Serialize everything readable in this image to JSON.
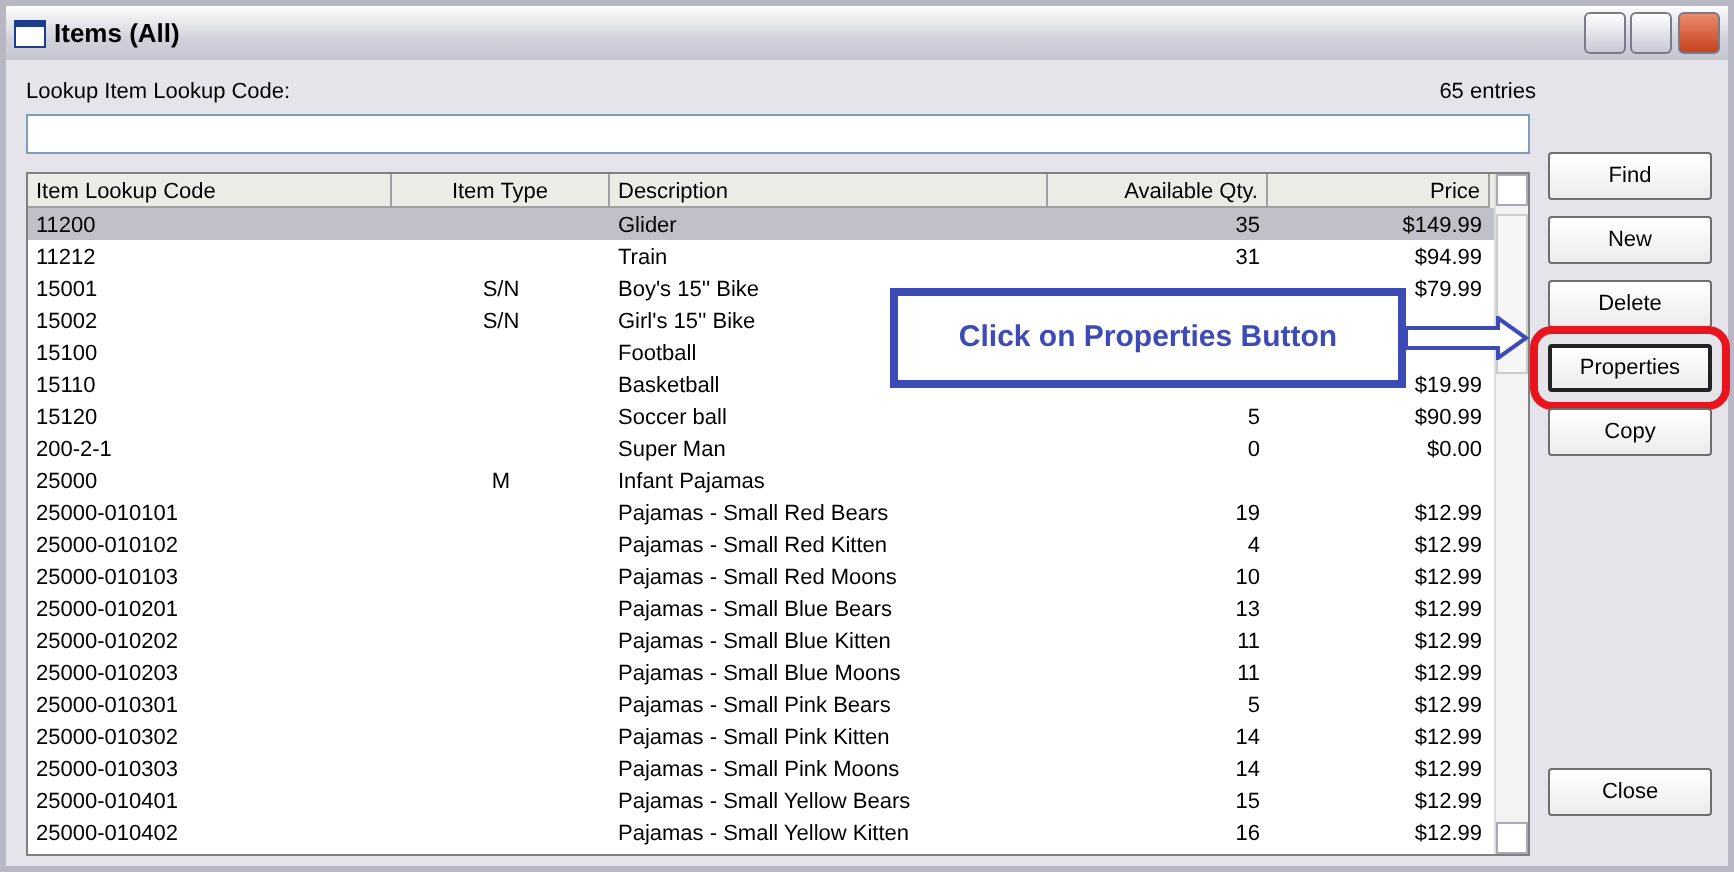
{
  "window": {
    "title": "Items (All)"
  },
  "lookup": {
    "label": "Lookup Item Lookup Code:",
    "count": "65 entries"
  },
  "table": {
    "columns": [
      "Item Lookup Code",
      "Item Type",
      "Description",
      "Available Qty.",
      "Price"
    ],
    "rows": [
      {
        "code": "11200",
        "type": "",
        "description": "Glider",
        "qty": "35",
        "price": "$149.99",
        "selected": true
      },
      {
        "code": "11212",
        "type": "",
        "description": "Train",
        "qty": "31",
        "price": "$94.99",
        "selected": false
      },
      {
        "code": "15001",
        "type": "S/N",
        "description": "Boy's 15'' Bike",
        "qty": "",
        "price": "$79.99",
        "selected": false
      },
      {
        "code": "15002",
        "type": "S/N",
        "description": "Girl's 15'' Bike",
        "qty": "",
        "price": "",
        "selected": false
      },
      {
        "code": "15100",
        "type": "",
        "description": "Football",
        "qty": "",
        "price": "",
        "selected": false
      },
      {
        "code": "15110",
        "type": "",
        "description": "Basketball",
        "qty": "",
        "price": "$19.99",
        "selected": false
      },
      {
        "code": "15120",
        "type": "",
        "description": "Soccer ball",
        "qty": "5",
        "price": "$90.99",
        "selected": false
      },
      {
        "code": "200-2-1",
        "type": "",
        "description": "Super Man",
        "qty": "0",
        "price": "$0.00",
        "selected": false
      },
      {
        "code": "25000",
        "type": "M",
        "description": "Infant Pajamas",
        "qty": "",
        "price": "",
        "selected": false
      },
      {
        "code": "25000-010101",
        "type": "",
        "description": "Pajamas - Small Red Bears",
        "qty": "19",
        "price": "$12.99",
        "selected": false
      },
      {
        "code": "25000-010102",
        "type": "",
        "description": "Pajamas - Small Red Kitten",
        "qty": "4",
        "price": "$12.99",
        "selected": false
      },
      {
        "code": "25000-010103",
        "type": "",
        "description": "Pajamas - Small Red Moons",
        "qty": "10",
        "price": "$12.99",
        "selected": false
      },
      {
        "code": "25000-010201",
        "type": "",
        "description": "Pajamas - Small Blue Bears",
        "qty": "13",
        "price": "$12.99",
        "selected": false
      },
      {
        "code": "25000-010202",
        "type": "",
        "description": "Pajamas - Small Blue Kitten",
        "qty": "11",
        "price": "$12.99",
        "selected": false
      },
      {
        "code": "25000-010203",
        "type": "",
        "description": "Pajamas - Small Blue Moons",
        "qty": "11",
        "price": "$12.99",
        "selected": false
      },
      {
        "code": "25000-010301",
        "type": "",
        "description": "Pajamas - Small Pink Bears",
        "qty": "5",
        "price": "$12.99",
        "selected": false
      },
      {
        "code": "25000-010302",
        "type": "",
        "description": "Pajamas - Small Pink Kitten",
        "qty": "14",
        "price": "$12.99",
        "selected": false
      },
      {
        "code": "25000-010303",
        "type": "",
        "description": "Pajamas - Small Pink Moons",
        "qty": "14",
        "price": "$12.99",
        "selected": false
      },
      {
        "code": "25000-010401",
        "type": "",
        "description": "Pajamas - Small Yellow Bears",
        "qty": "15",
        "price": "$12.99",
        "selected": false
      },
      {
        "code": "25000-010402",
        "type": "",
        "description": "Pajamas - Small Yellow Kitten",
        "qty": "16",
        "price": "$12.99",
        "selected": false
      }
    ]
  },
  "buttons": [
    {
      "label": "Find",
      "highlighted": false
    },
    {
      "label": "New",
      "highlighted": false
    },
    {
      "label": "Delete",
      "highlighted": false
    },
    {
      "label": "Properties",
      "highlighted": true
    },
    {
      "label": "Copy",
      "highlighted": false
    }
  ],
  "close_button": "Close",
  "callout": {
    "text": "Click on Properties Button"
  }
}
